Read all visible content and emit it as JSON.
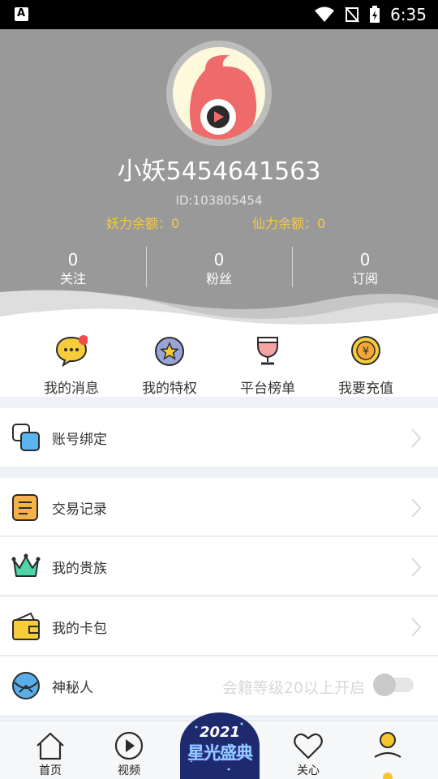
{
  "status_bar": {
    "time": "6:35",
    "app_indicator": "A"
  },
  "profile": {
    "username": "小妖5454641563",
    "user_id": "ID:103805454",
    "yao_balance_label": "妖力余额：",
    "yao_balance": "0",
    "xian_balance_label": "仙力余额：",
    "xian_balance": "0"
  },
  "stats": [
    {
      "value": "0",
      "label": "关注"
    },
    {
      "value": "0",
      "label": "粉丝"
    },
    {
      "value": "0",
      "label": "订阅"
    }
  ],
  "quick_actions": [
    {
      "label": "我的消息",
      "icon": "chat-bubble-icon",
      "has_badge": true
    },
    {
      "label": "我的特权",
      "icon": "star-badge-icon"
    },
    {
      "label": "平台榜单",
      "icon": "trophy-icon"
    },
    {
      "label": "我要充值",
      "icon": "yen-coin-icon"
    }
  ],
  "menu": {
    "account_binding": "账号绑定",
    "transactions": "交易记录",
    "nobility": "我的贵族",
    "card_wallet": "我的卡包",
    "mystery": {
      "label": "神秘人",
      "hint": "会籍等级20以上开启",
      "enabled": false
    }
  },
  "bottom_nav": {
    "home": "首页",
    "video": "视频",
    "promo_year": "2021",
    "promo_title": "星光盛典",
    "follow": "关心",
    "active": "me"
  },
  "colors": {
    "header_bg": "#999999",
    "balance_text": "#f3c947",
    "accent_yellow": "#f6c631",
    "accent_blue": "#4aa7e8"
  }
}
